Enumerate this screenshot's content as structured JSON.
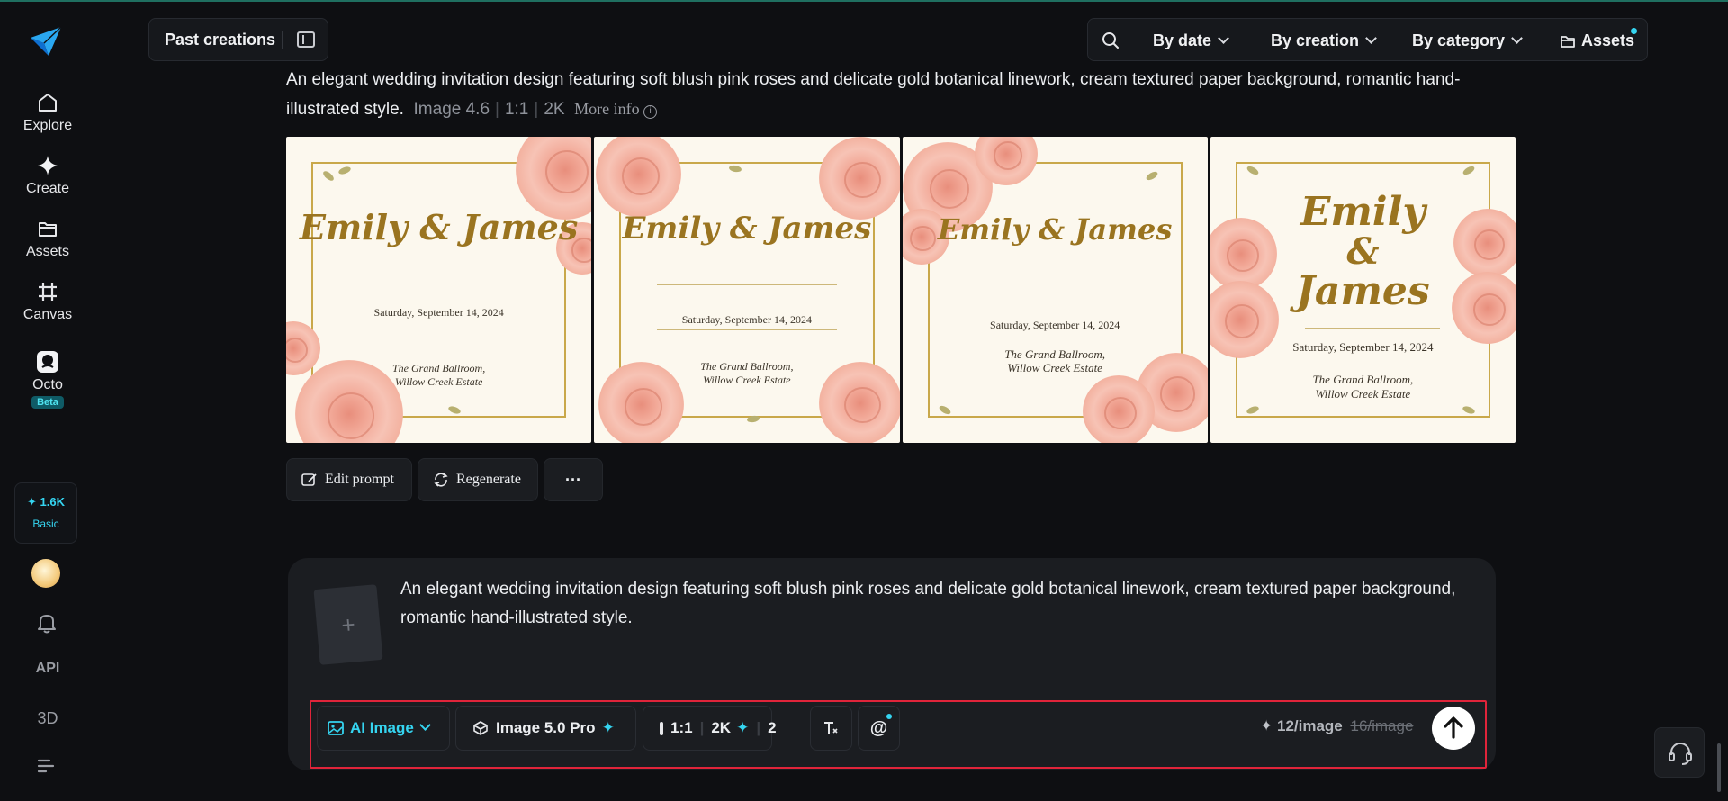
{
  "sidebar": {
    "nav": [
      {
        "label": "Explore",
        "icon": "home-icon"
      },
      {
        "label": "Create",
        "icon": "sparkle-icon"
      },
      {
        "label": "Assets",
        "icon": "folder-icon"
      },
      {
        "label": "Canvas",
        "icon": "crop-icon"
      },
      {
        "label": "Octo",
        "icon": "octo-icon",
        "badge": "Beta"
      }
    ],
    "credits": {
      "amount": "1.6K",
      "tier": "Basic"
    },
    "api_label": "API",
    "three_d_label": "3D"
  },
  "topbar": {
    "past_creations": "Past creations",
    "filters": [
      "By date",
      "By creation",
      "By category"
    ],
    "assets_label": "Assets"
  },
  "generation": {
    "prompt": "An elegant wedding invitation design featuring soft blush pink roses and delicate gold botanical linework, cream textured paper background, romantic hand-illustrated style.",
    "model": "Image 4.6",
    "ratio": "1:1",
    "resolution": "2K",
    "more_info": "More info",
    "cards": [
      {
        "names": "Emily & James",
        "date": "Saturday, September 14, 2024",
        "venue_line1": "The Grand Ballroom,",
        "venue_line2": "Willow Creek Estate"
      },
      {
        "names": "Emily & James",
        "date": "Saturday, September 14, 2024",
        "venue_line1": "The Grand Ballroom,",
        "venue_line2": "Willow Creek Estate"
      },
      {
        "names": "Emily & James",
        "date": "Saturday, September 14, 2024",
        "venue_line1": "The Grand Ballroom,",
        "venue_line2": "Willow Creek Estate"
      },
      {
        "names_line1": "Emily",
        "names_amp": "&",
        "names_line2": "James",
        "date": "Saturday, September 14, 2024",
        "venue_line1": "The Grand Ballroom,",
        "venue_line2": "Willow Creek Estate"
      }
    ],
    "actions": {
      "edit_prompt": "Edit prompt",
      "regenerate": "Regenerate",
      "more": "···"
    }
  },
  "composer": {
    "upload_symbol": "+",
    "text": "An elegant wedding invitation design featuring soft blush pink roses and delicate gold botanical linework, cream textured paper background, romantic hand-illustrated style.",
    "mode": "AI Image",
    "model": "Image 5.0 Pro",
    "ratio": "1:1",
    "resolution": "2K",
    "count": "2",
    "mention": "@",
    "price": "12/image",
    "old_price": "16/image"
  },
  "colors": {
    "accent": "#35d4f0",
    "highlight_outline": "#e0243a",
    "gold": "#9a7420",
    "background": "#0e0f12"
  }
}
